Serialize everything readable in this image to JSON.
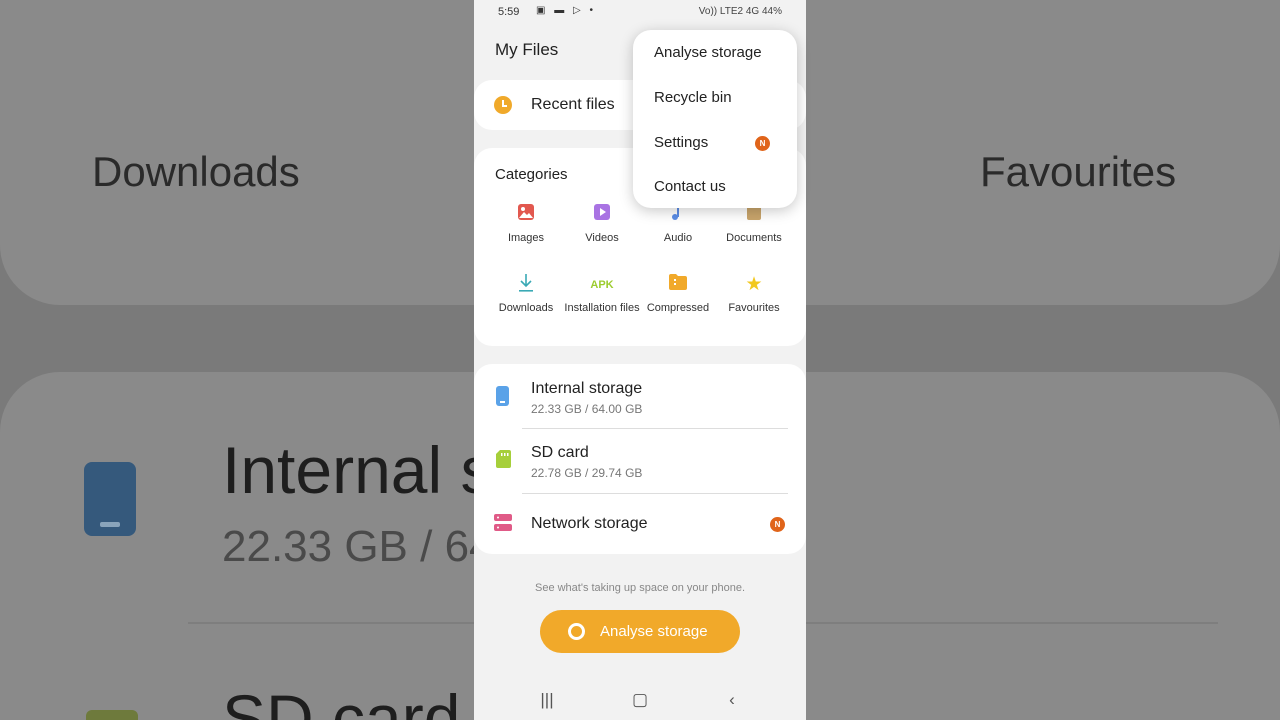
{
  "status_bar": {
    "time": "5:59",
    "notification_icons": "▣ ▬ ▷ •",
    "network": "Vo)) LTE2 4G",
    "battery": "44%"
  },
  "app": {
    "title": "My Files"
  },
  "recent": {
    "label": "Recent files"
  },
  "categories": {
    "title": "Categories",
    "items": [
      {
        "label": "Images",
        "icon": "image-icon",
        "color": "#e2584f"
      },
      {
        "label": "Videos",
        "icon": "video-icon",
        "color": "#a973e3"
      },
      {
        "label": "Audio",
        "icon": "music-icon",
        "color": "#5b8de6"
      },
      {
        "label": "Documents",
        "icon": "document-icon",
        "color": "#c9a56c"
      },
      {
        "label": "Downloads",
        "icon": "download-icon",
        "color": "#3aa9b5"
      },
      {
        "label": "Installation files",
        "icon": "apk-icon",
        "apk_text": "APK",
        "color": "#9ccc2f"
      },
      {
        "label": "Compressed",
        "icon": "folder-zip-icon",
        "color": "#f1a92a"
      },
      {
        "label": "Favourites",
        "icon": "star-icon",
        "color": "#f2c81f"
      }
    ]
  },
  "storage": {
    "items": [
      {
        "name": "Internal storage",
        "size": "22.33 GB / 64.00 GB",
        "icon": "phone-storage-icon",
        "color": "#5aa2e8"
      },
      {
        "name": "SD card",
        "size": "22.78 GB / 29.74 GB",
        "icon": "sd-card-icon",
        "color": "#a6cf3a"
      },
      {
        "name": "Network storage",
        "icon": "network-storage-icon",
        "color": "#e05a87",
        "badge": "N"
      }
    ]
  },
  "analyse": {
    "hint": "See what's taking up space on your phone.",
    "button_label": "Analyse storage"
  },
  "menu": {
    "items": [
      {
        "label": "Analyse storage"
      },
      {
        "label": "Recycle bin"
      },
      {
        "label": "Settings",
        "badge": "N"
      },
      {
        "label": "Contact us"
      }
    ]
  },
  "navbar": {
    "recents": "|||",
    "home": "▢",
    "back": "‹"
  }
}
